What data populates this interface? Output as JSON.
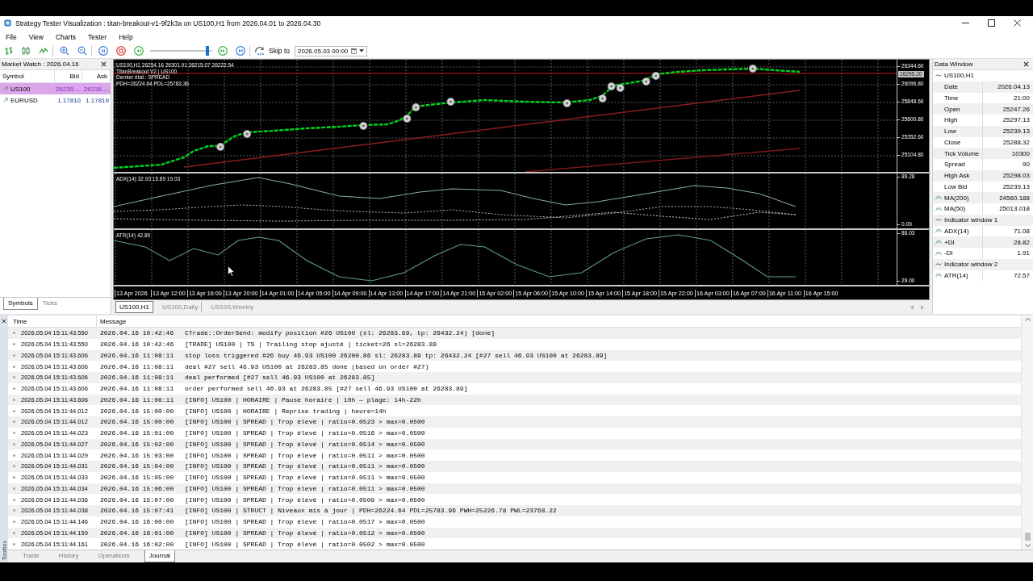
{
  "window": {
    "title": "Strategy Tester Visualization : titan-breakout-v1-9f2k3a on US100,H1 from 2026.04.01 to 2026.04.30"
  },
  "menu": [
    "File",
    "View",
    "Charts",
    "Tester",
    "Help"
  ],
  "toolbar": {
    "speed_slider": {
      "level": 0.96
    },
    "skip_to": {
      "label": "Skip to",
      "value": "2026.05.03 00:00"
    }
  },
  "market_watch": {
    "title": "Market Watch : 2026.04.16",
    "columns": [
      "Symbol",
      "Bid",
      "Ask"
    ],
    "rows": [
      {
        "symbol": "US100",
        "bid": "26235....",
        "ask": "26236....",
        "selected": true
      },
      {
        "symbol": "EURUSD",
        "bid": "1.17810",
        "ask": "1.17819",
        "selected": false
      }
    ],
    "tabs": [
      {
        "label": "Symbols",
        "selected": true
      },
      {
        "label": "Ticks",
        "selected": false
      }
    ]
  },
  "chart": {
    "info_lines": [
      "US100,H1 26254.16 26301.91 26215.07 26222.54",
      "TitanBreakout V2 | US100",
      "Dernier état : SPREAD",
      "PDH=26224.64 PDL=25783.36"
    ],
    "price_axis": [
      "26344.60",
      "26096.80",
      "25848.60",
      "25600.80",
      "25352.60",
      "25104.80"
    ],
    "current_price": "26295.20",
    "indicator_panes": [
      {
        "kind": "adx",
        "label": "ADX(14) 32.93 15.89 19.03",
        "axis": [
          "89.28",
          "0.00"
        ]
      },
      {
        "kind": "atr",
        "label": "ATR(14) 42.89",
        "axis": [
          "86.03",
          "29.00"
        ]
      }
    ],
    "time_axis": [
      "13 Apr 2026",
      "13 Apr 12:00",
      "13 Apr 16:00",
      "13 Apr 20:00",
      "14 Apr 01:00",
      "14 Apr 05:00",
      "14 Apr 09:00",
      "14 Apr 13:00",
      "14 Apr 17:00",
      "14 Apr 21:00",
      "15 Apr 02:00",
      "15 Apr 06:00",
      "15 Apr 10:00",
      "15 Apr 14:00",
      "15 Apr 18:00",
      "15 Apr 22:00",
      "16 Apr 03:00",
      "16 Apr 07:00",
      "16 Apr 11:00",
      "16 Apr 15:00"
    ]
  },
  "chart_tabs": [
    {
      "label": "US100,H1",
      "selected": true
    },
    {
      "label": "US100,Daily",
      "selected": false
    },
    {
      "label": "US100,Weekly",
      "selected": false
    }
  ],
  "data_window": {
    "title": "Data Window",
    "groups": [
      {
        "name": "US100,H1",
        "rows": [
          {
            "kind": "field",
            "label": "Date",
            "value": "2026.04.13"
          },
          {
            "kind": "field",
            "label": "Time",
            "value": "21:00"
          },
          {
            "kind": "field",
            "label": "Open",
            "value": "25247.26"
          },
          {
            "kind": "field",
            "label": "High",
            "value": "25297.13"
          },
          {
            "kind": "field",
            "label": "Low",
            "value": "25239.13"
          },
          {
            "kind": "field",
            "label": "Close",
            "value": "25288.32"
          },
          {
            "kind": "field",
            "label": "Tick Volume",
            "value": "10300"
          },
          {
            "kind": "field",
            "label": "Spread",
            "value": "90"
          },
          {
            "kind": "field",
            "label": "High Ask",
            "value": "25298.03"
          },
          {
            "kind": "field",
            "label": "Low Bid",
            "value": "25239.13"
          },
          {
            "kind": "indicator",
            "label": "MA(200)",
            "value": "24560.188"
          },
          {
            "kind": "indicator",
            "label": "MA(50)",
            "value": "25013.018"
          }
        ]
      },
      {
        "name": "Indicator window 1",
        "rows": [
          {
            "kind": "indicator",
            "label": "ADX(14)",
            "value": "71.08"
          },
          {
            "kind": "indicator",
            "label": "+DI",
            "value": "28.82"
          },
          {
            "kind": "indicator",
            "label": "-DI",
            "value": "1.91"
          }
        ]
      },
      {
        "name": "Indicator window 2",
        "rows": [
          {
            "kind": "indicator",
            "label": "ATR(14)",
            "value": "72.57"
          }
        ]
      }
    ]
  },
  "journal": {
    "columns": [
      "Time",
      "Message"
    ],
    "rows": [
      {
        "time": "2026.05.04 15:11:43.550",
        "message_time": "2026.04.16 10:42:46",
        "message": "CTrade::OrderSend: modify position #26 US100 (sl: 26283.89, tp: 26432.24) [done]"
      },
      {
        "time": "2026.05.04 15:11:43.550",
        "message_time": "2026.04.16 10:42:46",
        "message": "[TRADE] US100 | TS | Trailing stop ajusté | ticket=26 sl=26283.89"
      },
      {
        "time": "2026.05.04 15:11:43.606",
        "message_time": "2026.04.16 11:08:11",
        "message": "stop loss triggered #26 buy 46.93 US100 26200.86 sl: 26283.89 tp: 26432.24 [#27 sell 46.93 US100 at 26283.89]"
      },
      {
        "time": "2026.05.04 15:11:43.606",
        "message_time": "2026.04.16 11:08:11",
        "message": "deal #27 sell 46.93 US100 at 26283.85 done (based on order #27)"
      },
      {
        "time": "2026.05.04 15:11:43.606",
        "message_time": "2026.04.16 11:08:11",
        "message": "deal performed [#27 sell 46.93 US100 at 26283.85]"
      },
      {
        "time": "2026.05.04 15:11:43.606",
        "message_time": "2026.04.16 11:08:11",
        "message": "order performed sell 46.93 at 26283.85 [#27 sell 46.93 US100 at 26283.89]"
      },
      {
        "time": "2026.05.04 15:11:43.606",
        "message_time": "2026.04.16 11:08:11",
        "message": "[INFO] US100 | HORAIRE | Pause horaire | 10h — plage: 14h-22h"
      },
      {
        "time": "2026.05.04 15:11:44.012",
        "message_time": "2026.04.16 15:00:00",
        "message": "[INFO] US100 | HORAIRE | Reprise trading | heure=14h"
      },
      {
        "time": "2026.05.04 15:11:44.012",
        "message_time": "2026.04.16 15:00:00",
        "message": "[INFO] US100 | SPREAD | Trop élevé | ratio=0.0523 > max=0.0500"
      },
      {
        "time": "2026.05.04 15:11:44.023",
        "message_time": "2026.04.16 15:01:00",
        "message": "[INFO] US100 | SPREAD | Trop élevé | ratio=0.0516 > max=0.0500"
      },
      {
        "time": "2026.05.04 15:11:44.027",
        "message_time": "2026.04.16 15:02:00",
        "message": "[INFO] US100 | SPREAD | Trop élevé | ratio=0.0514 > max=0.0500"
      },
      {
        "time": "2026.05.04 15:11:44.029",
        "message_time": "2026.04.16 15:03:00",
        "message": "[INFO] US100 | SPREAD | Trop élevé | ratio=0.0511 > max=0.0500"
      },
      {
        "time": "2026.05.04 15:11:44.031",
        "message_time": "2026.04.16 15:04:00",
        "message": "[INFO] US100 | SPREAD | Trop élevé | ratio=0.0511 > max=0.0500"
      },
      {
        "time": "2026.05.04 15:11:44.033",
        "message_time": "2026.04.16 15:05:00",
        "message": "[INFO] US100 | SPREAD | Trop élevé | ratio=0.0511 > max=0.0500"
      },
      {
        "time": "2026.05.04 15:11:44.034",
        "message_time": "2026.04.16 15:06:00",
        "message": "[INFO] US100 | SPREAD | Trop élevé | ratio=0.0511 > max=0.0500"
      },
      {
        "time": "2026.05.04 15:11:44.036",
        "message_time": "2026.04.16 15:07:00",
        "message": "[INFO] US100 | SPREAD | Trop élevé | ratio=0.0509 > max=0.0500"
      },
      {
        "time": "2026.05.04 15:11:44.038",
        "message_time": "2026.04.16 15:07:41",
        "message": "[INFO] US100 | STRUCT | Niveaux mis à jour | PDH=26224.64 PDL=25783.96 PWH=25226.78 PWL=23768.22"
      },
      {
        "time": "2026.05.04 15:11:44.146",
        "message_time": "2026.04.16 16:00:00",
        "message": "[INFO] US100 | SPREAD | Trop élevé | ratio=0.0517 > max=0.0500"
      },
      {
        "time": "2026.05.04 15:11:44.159",
        "message_time": "2026.04.16 16:01:00",
        "message": "[INFO] US100 | SPREAD | Trop élevé | ratio=0.0512 > max=0.0500"
      },
      {
        "time": "2026.05.04 15:11:44.161",
        "message_time": "2026.04.16 16:02:00",
        "message": "[INFO] US100 | SPREAD | Trop élevé | ratio=0.0502 > max=0.0500"
      }
    ]
  },
  "toolbox": {
    "label": "Toolbox"
  },
  "bottom_tabs": [
    {
      "label": "Trade",
      "selected": false
    },
    {
      "label": "History",
      "selected": false
    },
    {
      "label": "Operations",
      "selected": false
    },
    {
      "label": "Journal",
      "selected": true
    }
  ]
}
